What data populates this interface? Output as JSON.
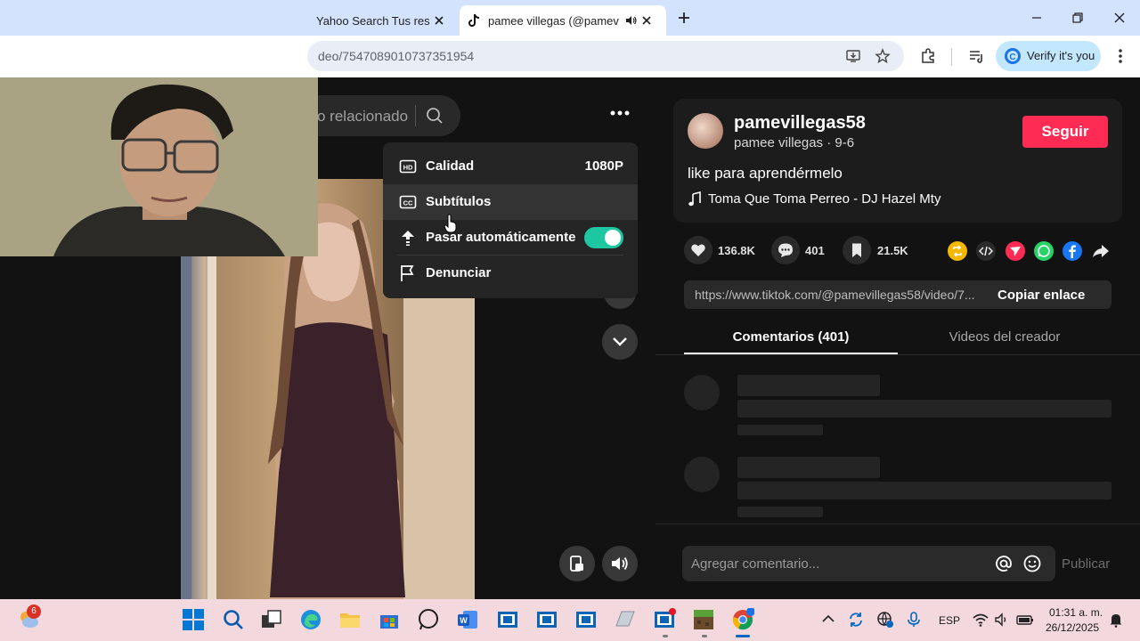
{
  "browser": {
    "tabs": [
      {
        "title": "Yahoo Search Tus resul"
      },
      {
        "title": "pamee villegas (@pamevilla"
      }
    ],
    "new_tab_symbol": "+",
    "url": "deo/7547089010737351954",
    "verify_label": "Verify it's you"
  },
  "video": {
    "search_text": "o relacionado",
    "menu": {
      "items": [
        {
          "label": "Calidad",
          "value": "1080P",
          "icon": "hd-icon"
        },
        {
          "label": "Subtítulos",
          "icon": "cc-icon"
        },
        {
          "label": "Pasar automáticamente",
          "icon": "autoscroll-icon",
          "toggle": "on"
        },
        {
          "label": "Denunciar",
          "icon": "flag-icon"
        }
      ]
    }
  },
  "post": {
    "username": "pamevillegas58",
    "display_name_date": "pamee villegas · 9-6",
    "follow_label": "Seguir",
    "caption": "like para aprendérmelo",
    "music": "Toma Que Toma Perreo - DJ Hazel Mty",
    "likes": "136.8K",
    "comments": "401",
    "saves": "21.5K",
    "link": "https://www.tiktok.com/@pamevillegas58/video/7...",
    "copy_label": "Copiar enlace",
    "tabs": [
      "Comentarios (401)",
      "Videos del creador"
    ],
    "comment_placeholder": "Agregar comentario...",
    "publish_label": "Publicar"
  },
  "colors": {
    "accent": "#fe2c55",
    "toggle_on": "#1dc7a1",
    "background": "#121212"
  },
  "taskbar": {
    "weather_badge": "6",
    "language": "ESP",
    "time": "01:31 a. m.",
    "date": "26/12/2025"
  }
}
